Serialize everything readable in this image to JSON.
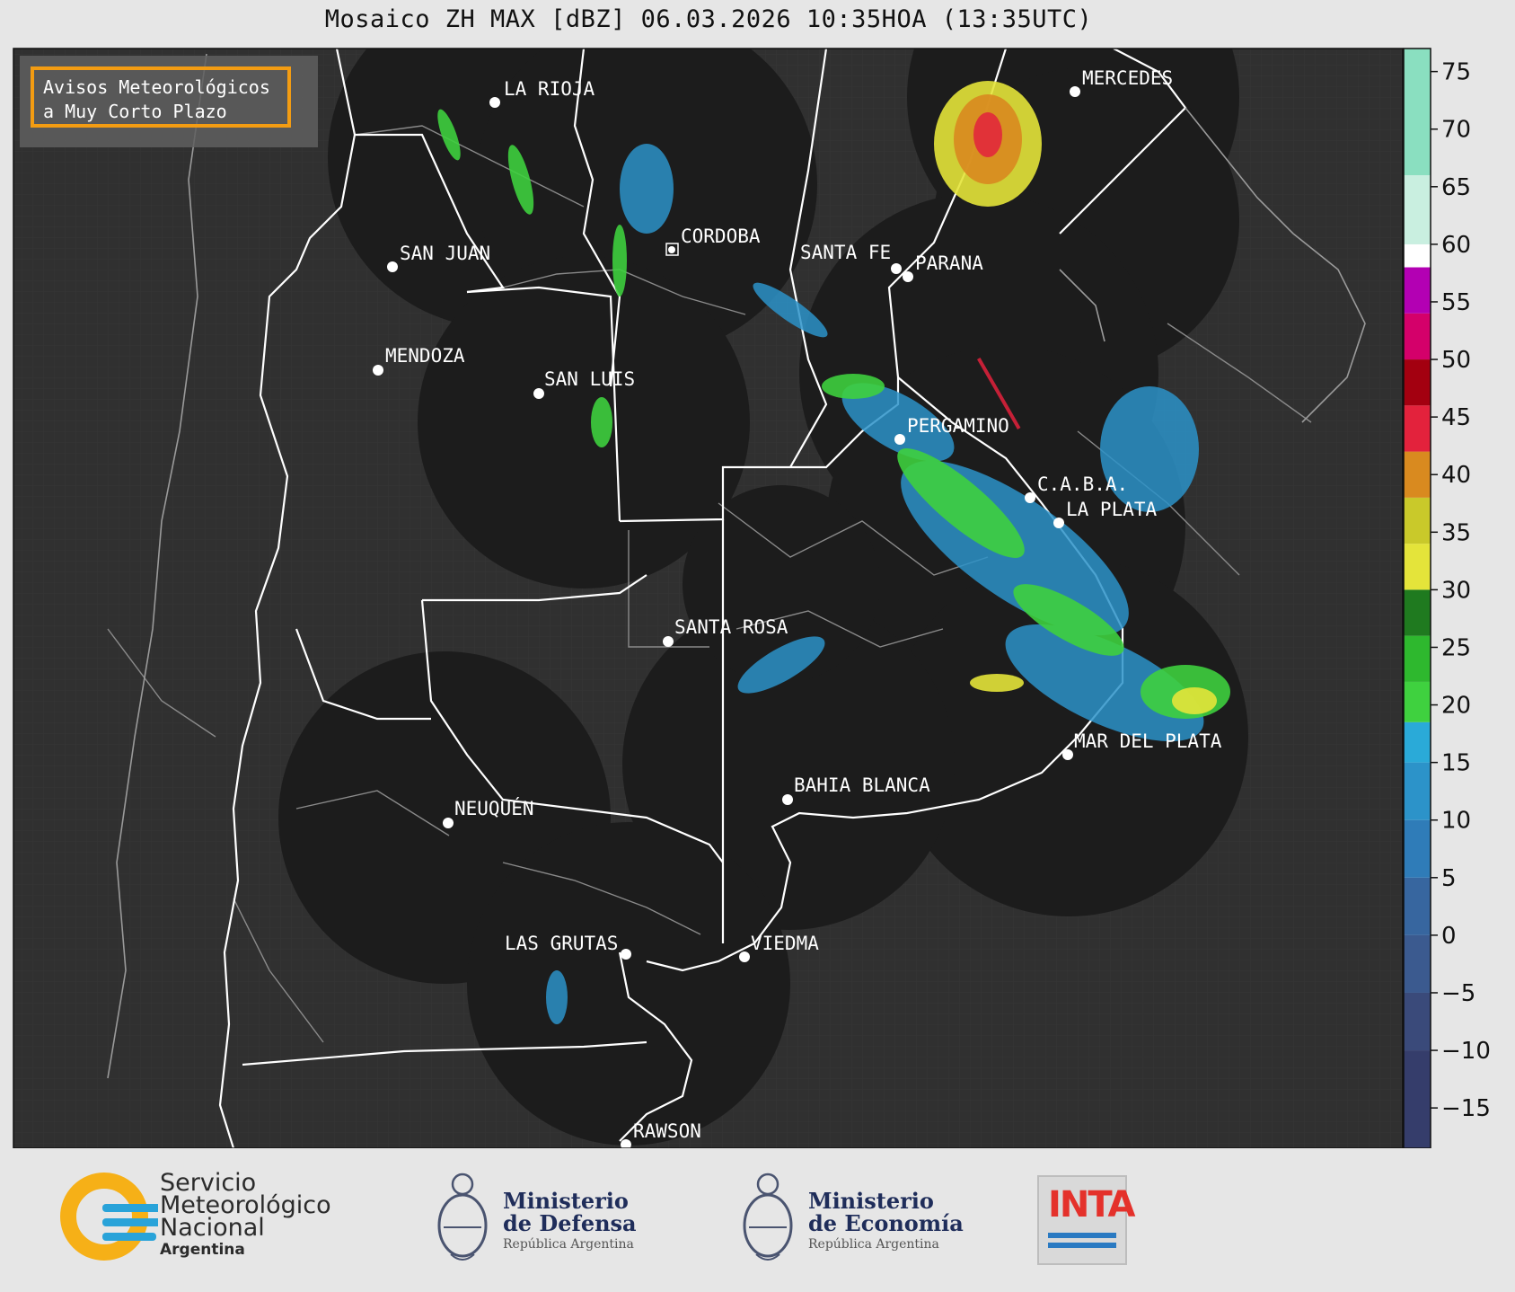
{
  "title": "Mosaico ZH MAX [dBZ] 06.03.2026 10:35HOA (13:35UTC)",
  "badge": {
    "line1": "Avisos Meteorológicos",
    "line2": "a Muy Corto Plazo"
  },
  "cities": [
    {
      "name": "LA RIOJA",
      "icon": "dot"
    },
    {
      "name": "MERCEDES",
      "icon": "dot"
    },
    {
      "name": "SAN JUAN",
      "icon": "dot"
    },
    {
      "name": "CORDOBA",
      "icon": "square-dot"
    },
    {
      "name": "SANTA FE",
      "icon": "dot"
    },
    {
      "name": "PARANA",
      "icon": "dot"
    },
    {
      "name": "MENDOZA",
      "icon": "dot"
    },
    {
      "name": "SAN LUIS",
      "icon": "dot"
    },
    {
      "name": "PERGAMINO",
      "icon": "dot"
    },
    {
      "name": "C.A.B.A.",
      "icon": "dot"
    },
    {
      "name": "LA PLATA",
      "icon": "dot"
    },
    {
      "name": "SANTA ROSA",
      "icon": "dot"
    },
    {
      "name": "MAR DEL PLATA",
      "icon": "dot"
    },
    {
      "name": "BAHIA BLANCA",
      "icon": "dot"
    },
    {
      "name": "NEUQUÉN",
      "icon": "dot"
    },
    {
      "name": "LAS GRUTAS",
      "icon": "dot"
    },
    {
      "name": "VIEDMA",
      "icon": "dot"
    },
    {
      "name": "RAWSON",
      "icon": "dot"
    }
  ],
  "colorbar": {
    "unit": "dBZ",
    "range": [
      -18.5,
      77
    ],
    "ticks": [
      "75",
      "70",
      "65",
      "60",
      "55",
      "50",
      "45",
      "40",
      "35",
      "30",
      "25",
      "20",
      "15",
      "10",
      "5",
      "0",
      "−5",
      "−10",
      "−15"
    ],
    "tick_values": [
      75,
      70,
      65,
      60,
      55,
      50,
      45,
      40,
      35,
      30,
      25,
      20,
      15,
      10,
      5,
      0,
      -5,
      -10,
      -15
    ],
    "stops": [
      {
        "from": -18.5,
        "to": -10,
        "color": "#353d6b"
      },
      {
        "from": -10,
        "to": -5,
        "color": "#3a4a7a"
      },
      {
        "from": -5,
        "to": 0,
        "color": "#3b5a8f"
      },
      {
        "from": 0,
        "to": 5,
        "color": "#37669f"
      },
      {
        "from": 5,
        "to": 10,
        "color": "#2f7cb8"
      },
      {
        "from": 10,
        "to": 15,
        "color": "#2c93c9"
      },
      {
        "from": 15,
        "to": 18.5,
        "color": "#2aaad8"
      },
      {
        "from": 18.5,
        "to": 22,
        "color": "#3fd13f"
      },
      {
        "from": 22,
        "to": 26,
        "color": "#2eb82e"
      },
      {
        "from": 26,
        "to": 30,
        "color": "#1f7a1f"
      },
      {
        "from": 30,
        "to": 34,
        "color": "#e4e43a"
      },
      {
        "from": 34,
        "to": 38,
        "color": "#c9c92a"
      },
      {
        "from": 38,
        "to": 42,
        "color": "#d98a1f"
      },
      {
        "from": 42,
        "to": 46,
        "color": "#e3223c"
      },
      {
        "from": 46,
        "to": 50,
        "color": "#a30010"
      },
      {
        "from": 50,
        "to": 54,
        "color": "#d4006a"
      },
      {
        "from": 54,
        "to": 58,
        "color": "#b300b3"
      },
      {
        "from": 58,
        "to": 60,
        "color": "#ffffff"
      },
      {
        "from": 60,
        "to": 66,
        "color": "#c9efe0"
      },
      {
        "from": 66,
        "to": 77,
        "color": "#8adfc0"
      }
    ]
  },
  "logos": {
    "smn": {
      "line1": "Servicio",
      "line2": "Meteorológico",
      "line3": "Nacional",
      "country": "Argentina"
    },
    "defensa": {
      "line1": "Ministerio",
      "line2": "de Defensa",
      "country": "República Argentina"
    },
    "economia": {
      "line1": "Ministerio",
      "line2": "de Economía",
      "country": "República Argentina"
    },
    "inta": {
      "name": "INTA"
    }
  },
  "colors": {
    "map_background": "#323232",
    "radar_coverage": "#1c1c1c",
    "province_border": "#ffffff",
    "badge_border": "#f39c12"
  }
}
